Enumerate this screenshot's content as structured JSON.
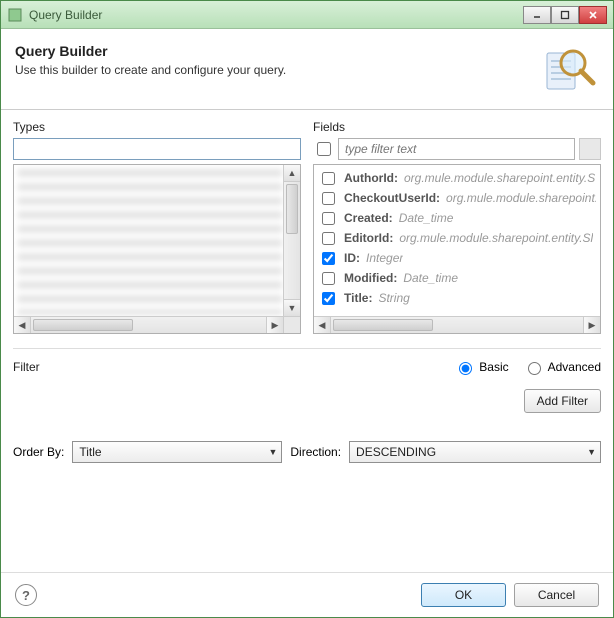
{
  "window": {
    "title": "Query Builder"
  },
  "header": {
    "title": "Query Builder",
    "description": "Use this builder to create and configure your query."
  },
  "types": {
    "label": "Types",
    "input_value": ""
  },
  "fields": {
    "label": "Fields",
    "filter_placeholder": "type filter text",
    "filter_checked": false,
    "items": [
      {
        "name": "AuthorId:",
        "type": "org.mule.module.sharepoint.entity.S",
        "checked": false
      },
      {
        "name": "CheckoutUserId:",
        "type": "org.mule.module.sharepoint.",
        "checked": false
      },
      {
        "name": "Created:",
        "type": "Date_time",
        "checked": false
      },
      {
        "name": "EditorId:",
        "type": "org.mule.module.sharepoint.entity.Sl",
        "checked": false
      },
      {
        "name": "ID:",
        "type": "Integer",
        "checked": true
      },
      {
        "name": "Modified:",
        "type": "Date_time",
        "checked": false
      },
      {
        "name": "Title:",
        "type": "String",
        "checked": true
      }
    ]
  },
  "filter": {
    "label": "Filter",
    "mode_basic": "Basic",
    "mode_advanced": "Advanced",
    "selected": "Basic",
    "add_filter_label": "Add Filter"
  },
  "order": {
    "order_by_label": "Order By:",
    "order_by_value": "Title",
    "direction_label": "Direction:",
    "direction_value": "DESCENDING"
  },
  "footer": {
    "ok": "OK",
    "cancel": "Cancel"
  }
}
